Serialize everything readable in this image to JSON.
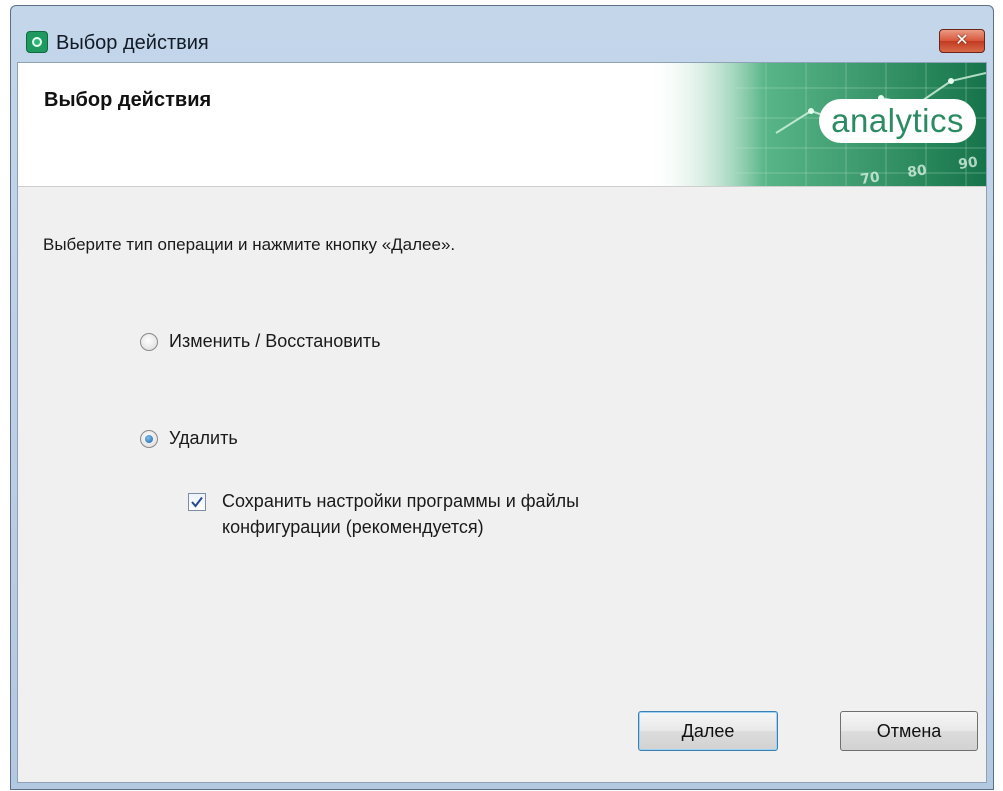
{
  "window": {
    "title": "Выбор действия",
    "close_glyph": "✕"
  },
  "header": {
    "title": "Выбор действия",
    "logo_text": "analytics",
    "banner_numbers": [
      "70",
      "80",
      "90"
    ]
  },
  "main": {
    "instruction": "Выберите тип операции и нажмите кнопку «Далее».",
    "options": [
      {
        "label": "Изменить / Восстановить",
        "selected": false
      },
      {
        "label": "Удалить",
        "selected": true
      }
    ],
    "keep_settings": {
      "label": "Сохранить настройки программы и файлы конфигурации (рекомендуется)",
      "checked": true
    }
  },
  "buttons": {
    "next": "Далее",
    "cancel": "Отмена"
  },
  "colors": {
    "brand_green": "#2b8c63",
    "accent_blue": "#1d5fa8"
  },
  "icons": {
    "app": "app-icon",
    "close": "close-icon",
    "radio": "radio-button",
    "check": "checkmark-icon"
  }
}
